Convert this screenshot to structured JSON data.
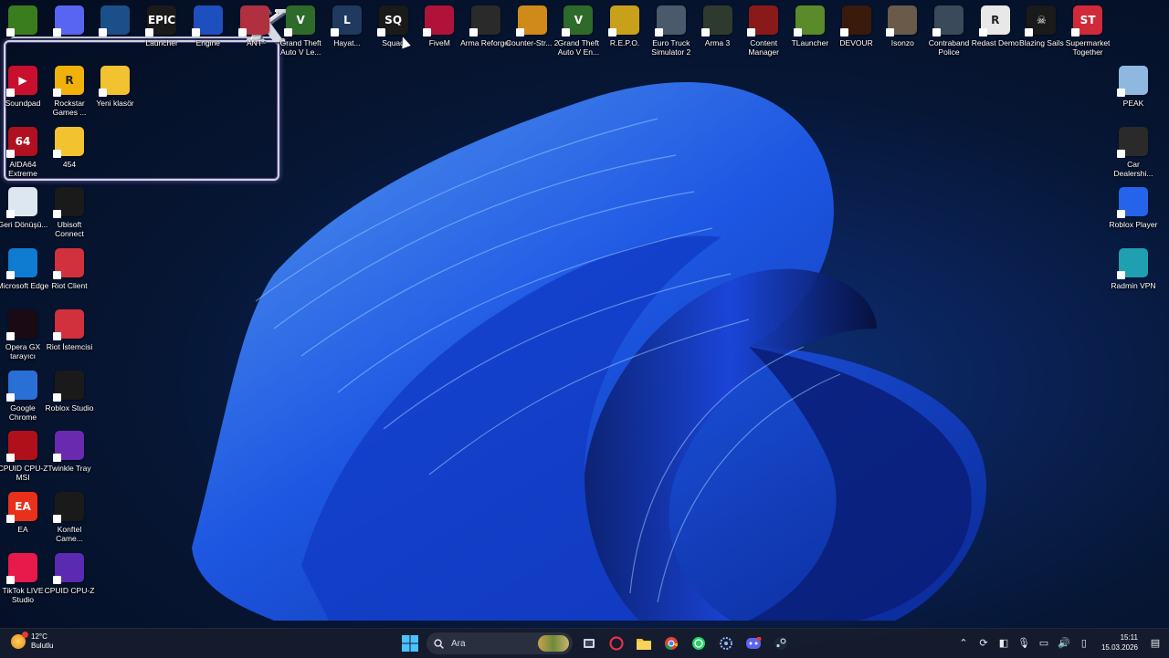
{
  "desktop": {
    "top_row": [
      {
        "id": "nvidia",
        "label": "",
        "icon": "nvidia-icon",
        "color": "#3a7d1f",
        "glyph": "",
        "x": 0
      },
      {
        "id": "discord",
        "label": "",
        "icon": "discord-icon",
        "color": "#5865f2",
        "glyph": "",
        "x": 1
      },
      {
        "id": "steam",
        "label": "",
        "icon": "steam-icon",
        "color": "#1b4f8a",
        "glyph": "",
        "x": 2
      },
      {
        "id": "epic",
        "label": "Launcher",
        "icon": "epic-games-icon",
        "color": "#1a1a1a",
        "glyph": "EPIC",
        "x": 3
      },
      {
        "id": "unreal",
        "label": "Engine",
        "icon": "unreal-engine-icon",
        "color": "#1e4fbf",
        "glyph": "",
        "x": 4
      },
      {
        "id": "valorant",
        "label": "ANT",
        "icon": "valorant-icon",
        "color": "#b03040",
        "glyph": "",
        "x": 5
      },
      {
        "id": "gtav1",
        "label": "Grand Theft Auto V Le...",
        "icon": "gta-v-icon",
        "color": "#2e6b2a",
        "glyph": "V",
        "x": 6
      },
      {
        "id": "lol",
        "label": "Hayat...",
        "icon": "league-of-legends-icon",
        "color": "#1f3a5e",
        "glyph": "L",
        "x": 7
      },
      {
        "id": "squad",
        "label": "Squad",
        "icon": "squad-icon",
        "color": "#1a1a1a",
        "glyph": "SQ",
        "x": 8
      },
      {
        "id": "fivem",
        "label": "FiveM",
        "icon": "fivem-icon",
        "color": "#b0123a",
        "glyph": "",
        "x": 9
      },
      {
        "id": "arma_reforger",
        "label": "Arma Reforger",
        "icon": "arma-reforger-icon",
        "color": "#2a2a2a",
        "glyph": "",
        "x": 10
      },
      {
        "id": "cs2",
        "label": "Counter-Str... 2",
        "icon": "counter-strike-icon",
        "color": "#d08a1a",
        "glyph": "",
        "x": 11
      },
      {
        "id": "gtav2",
        "label": "Grand Theft Auto V En...",
        "icon": "gta-v-icon",
        "color": "#2e6b2a",
        "glyph": "V",
        "x": 12
      },
      {
        "id": "repo",
        "label": "R.E.P.O.",
        "icon": "repo-icon",
        "color": "#c9a01a",
        "glyph": "",
        "x": 13
      },
      {
        "id": "ets2",
        "label": "Euro Truck Simulator 2",
        "icon": "euro-truck-icon",
        "color": "#4a5a6a",
        "glyph": "",
        "x": 14
      },
      {
        "id": "arma3",
        "label": "Arma 3",
        "icon": "arma-3-icon",
        "color": "#2f3a2f",
        "glyph": "",
        "x": 15
      },
      {
        "id": "content_manager",
        "label": "Content Manager",
        "icon": "content-manager-icon",
        "color": "#8a1a1a",
        "glyph": "",
        "x": 16
      },
      {
        "id": "tlauncher",
        "label": "TLauncher",
        "icon": "minecraft-icon",
        "color": "#5a8a2a",
        "glyph": "",
        "x": 17
      },
      {
        "id": "devour",
        "label": "DEVOUR",
        "icon": "devour-icon",
        "color": "#3a1a0a",
        "glyph": "",
        "x": 18
      },
      {
        "id": "isonzo",
        "label": "Isonzo",
        "icon": "isonzo-icon",
        "color": "#6a5a4a",
        "glyph": "",
        "x": 19
      },
      {
        "id": "contraband",
        "label": "Contraband Police",
        "icon": "contraband-police-icon",
        "color": "#3a4a5a",
        "glyph": "",
        "x": 20
      },
      {
        "id": "redact",
        "label": "Redast Demo",
        "icon": "redact-demo-icon",
        "color": "#e8e8e8",
        "glyph": "R",
        "x": 21
      },
      {
        "id": "blazing",
        "label": "Blazing Sails",
        "icon": "blazing-sails-icon",
        "color": "#1a1a1a",
        "glyph": "☠",
        "x": 22
      },
      {
        "id": "supermarket",
        "label": "Supermarket Together",
        "icon": "supermarket-together-icon",
        "color": "#d02a3a",
        "glyph": "ST",
        "x": 23
      }
    ],
    "left_col1": [
      {
        "id": "soundpad",
        "label": "Soundpad",
        "icon": "soundpad-icon",
        "color": "#c8102e",
        "glyph": "▶",
        "y": 0
      },
      {
        "id": "aida",
        "label": "AIDA64 Extreme",
        "icon": "aida64-icon",
        "color": "#b01020",
        "glyph": "64",
        "y": 1
      },
      {
        "id": "recycle",
        "label": "Geri Dönüşü...",
        "icon": "recycle-bin-icon",
        "color": "#dde7f2",
        "glyph": "",
        "y": 2
      },
      {
        "id": "edge",
        "label": "Microsoft Edge",
        "icon": "edge-icon",
        "color": "#0f7bd1",
        "glyph": "",
        "y": 3
      },
      {
        "id": "opera",
        "label": "Opera GX tarayıcı",
        "icon": "opera-gx-icon",
        "color": "#1a0a14",
        "glyph": "",
        "y": 4
      },
      {
        "id": "chrome",
        "label": "Google Chrome",
        "icon": "chrome-icon",
        "color": "#2a6fd6",
        "glyph": "",
        "y": 5
      },
      {
        "id": "cpuz_msi",
        "label": "CPUID CPU-Z MSI",
        "icon": "cpuz-msi-icon",
        "color": "#b0101a",
        "glyph": "",
        "y": 6
      },
      {
        "id": "ea",
        "label": "EA",
        "icon": "ea-icon",
        "color": "#e8301a",
        "glyph": "EA",
        "y": 7
      },
      {
        "id": "tiktok",
        "label": "TikTok LIVE Studio",
        "icon": "tiktok-live-icon",
        "color": "#e8194b",
        "glyph": "",
        "y": 8
      }
    ],
    "left_col2": [
      {
        "id": "rockstar",
        "label": "Rockstar Games ...",
        "icon": "rockstar-icon",
        "color": "#f0b10a",
        "glyph": "R",
        "y": 0
      },
      {
        "id": "folder454",
        "label": "454",
        "icon": "folder-icon",
        "color": "#f2c230",
        "glyph": "",
        "y": 1
      },
      {
        "id": "ubisoft",
        "label": "Ubisoft Connect",
        "icon": "ubisoft-icon",
        "color": "#1a1a1a",
        "glyph": "",
        "y": 2
      },
      {
        "id": "riot",
        "label": "Riot Client",
        "icon": "riot-client-icon",
        "color": "#d1313d",
        "glyph": "",
        "y": 3
      },
      {
        "id": "riot2",
        "label": "Riot İstemcisi",
        "icon": "riot-client-icon",
        "color": "#d1313d",
        "glyph": "",
        "y": 4
      },
      {
        "id": "roblox_studio",
        "label": "Roblox Studio",
        "icon": "roblox-studio-icon",
        "color": "#1a1a1a",
        "glyph": "",
        "y": 5
      },
      {
        "id": "twinkle",
        "label": "Twinkle Tray",
        "icon": "twinkle-tray-icon",
        "color": "#6a2ab0",
        "glyph": "",
        "y": 6
      },
      {
        "id": "konftel",
        "label": "Konftel Came...",
        "icon": "konftel-icon",
        "color": "#1a1a1a",
        "glyph": "",
        "y": 7
      },
      {
        "id": "cpuz",
        "label": "CPUID CPU-Z",
        "icon": "cpuz-icon",
        "color": "#5a2ab0",
        "glyph": "",
        "y": 8
      }
    ],
    "left_col3": [
      {
        "id": "yeni",
        "label": "Yeni klasör",
        "icon": "folder-icon",
        "color": "#f2c230",
        "glyph": "",
        "y": 0
      }
    ],
    "right_col": [
      {
        "id": "peak",
        "label": "PEAK",
        "icon": "peak-icon",
        "color": "#8fb8e0",
        "glyph": "",
        "y": 1
      },
      {
        "id": "car_dealer",
        "label": "Car Dealershi...",
        "icon": "car-dealership-icon",
        "color": "#2a2a2a",
        "glyph": "",
        "y": 2
      },
      {
        "id": "roblox",
        "label": "Roblox Player",
        "icon": "roblox-icon",
        "color": "#2563eb",
        "glyph": "",
        "y": 3
      },
      {
        "id": "radmin",
        "label": "Radmin VPN",
        "icon": "radmin-vpn-icon",
        "color": "#1fa0b0",
        "glyph": "",
        "y": 4
      }
    ]
  },
  "taskbar": {
    "weather": {
      "temp": "12°C",
      "desc": "Bulutlu"
    },
    "search_placeholder": "Ara",
    "clock": {
      "time": "15:11",
      "date": "15.03.2026"
    }
  }
}
